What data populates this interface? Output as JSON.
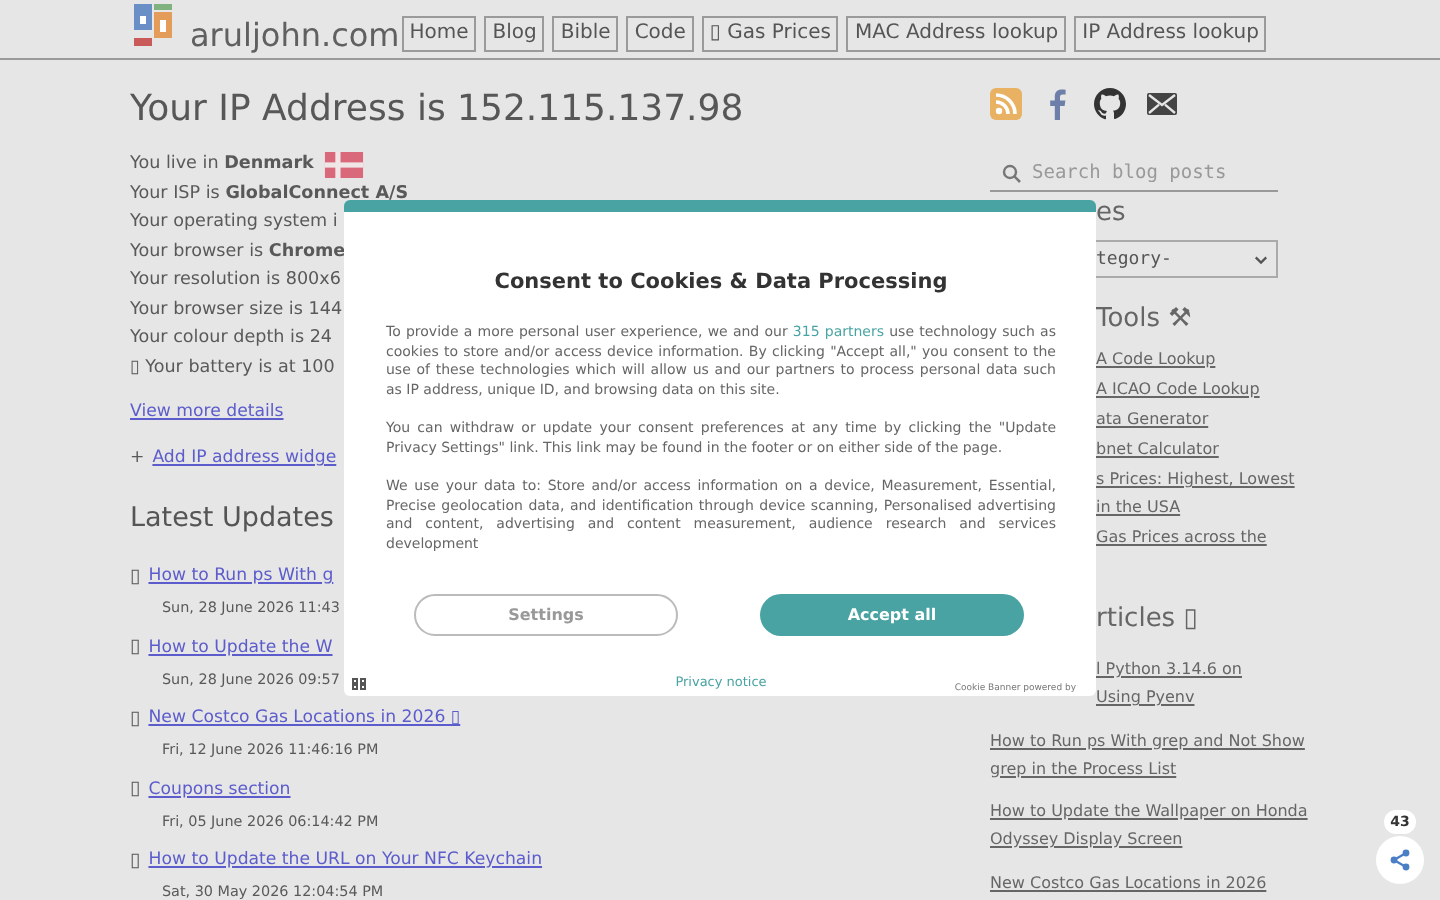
{
  "header": {
    "site_name": "aruljohn.com",
    "nav": [
      {
        "label": "Home"
      },
      {
        "label": "Blog"
      },
      {
        "label": "Bible"
      },
      {
        "label": "Code"
      },
      {
        "label": "▯ Gas Prices"
      },
      {
        "label": "MAC Address lookup"
      },
      {
        "label": "IP Address lookup"
      }
    ]
  },
  "main": {
    "title": "Your IP Address is 152.115.137.98",
    "info_lines": [
      {
        "text": "You live in **Denmark**",
        "flag": true
      },
      {
        "text": "Your ISP is **GlobalConnect A/S**",
        "flag": false
      },
      {
        "text": "Your operating system i",
        "flag": false
      },
      {
        "text": "Your browser is **Chrome**",
        "flag": false
      },
      {
        "text": "Your resolution is 800x6",
        "flag": false
      },
      {
        "text": "Your browser size is 144",
        "flag": false
      },
      {
        "text": "Your colour depth is 24",
        "flag": false
      },
      {
        "text": "▯ Your battery is at 100",
        "flag": false
      }
    ],
    "view_more_link": "View more details",
    "widget_link": {
      "prefix": "+",
      "label": "Add IP address widge"
    },
    "latest": {
      "heading": "Latest Updates",
      "items": [
        {
          "icon": "▯",
          "title": "How to Run ps With g",
          "date": "Sun, 28 June 2026 11:43"
        },
        {
          "icon": "▯",
          "title": "How to Update the W",
          "date": "Sun, 28 June 2026 09:57"
        },
        {
          "icon": "▯",
          "title": "New Costco Gas Locations in 2026 ▯",
          "date": "Fri, 12 June 2026 11:46:16 PM"
        },
        {
          "icon": "▯",
          "title": "Coupons section",
          "date": "Fri, 05 June 2026 06:14:42 PM"
        },
        {
          "icon": "▯",
          "title": "How to Update the URL on Your NFC Keychain",
          "date": "Sat, 30 May 2026 12:04:54 PM"
        }
      ]
    }
  },
  "sidebar": {
    "search": {
      "placeholder": "Search blog posts"
    },
    "categories": {
      "heading": "es",
      "select": "tegory-"
    },
    "tools": {
      "heading": "Tools ⚒",
      "links": [
        {
          "lines": [
            "A Code Lookup"
          ]
        },
        {
          "lines": [
            "A ICAO Code Lookup"
          ]
        },
        {
          "lines": [
            "ata Generator"
          ]
        },
        {
          "lines": [
            "bnet Calculator"
          ]
        },
        {
          "lines": [
            "s Prices: Highest, Lowest",
            "in the USA"
          ]
        },
        {
          "lines": [
            "Gas Prices across the"
          ]
        }
      ]
    },
    "articles": {
      "heading": "rticles ▯",
      "links": [
        {
          "kind": "covered",
          "lines": [
            "l Python 3.14.6 on",
            "Using Pyenv"
          ]
        },
        {
          "kind": "full",
          "lines": [
            "How to Run ps With grep and Not Show",
            "grep in the Process List"
          ]
        },
        {
          "kind": "full",
          "lines": [
            "How to Update the Wallpaper on Honda",
            "Odyssey Display Screen"
          ]
        },
        {
          "kind": "full",
          "lines": [
            "New Costco Gas Locations in 2026"
          ]
        }
      ]
    }
  },
  "consent_dialog": {
    "title": "Consent to Cookies & Data Processing",
    "paragraphs": [
      {
        "parts": [
          {
            "kind": "text",
            "text": "To provide a more personal user experience, we and our "
          },
          {
            "kind": "link",
            "text": "315 partners"
          },
          {
            "kind": "text",
            "text": " use technology such as cookies to store and/or access device information. By clicking \"Accept all,\" you consent to the use of these technologies which will allow us and our partners to process personal data such as IP address, unique ID, and browsing data on this site."
          }
        ]
      },
      {
        "parts": [
          {
            "kind": "text",
            "text": "You can withdraw or update your consent preferences at any time by clicking the \"Update Privacy Settings\" link. This link may be found in the footer or on either side of the page."
          }
        ]
      },
      {
        "parts": [
          {
            "kind": "text",
            "text": "We use your data to: Store and/or access information on a device, Measurement, Essential, Precise geolocation data, and identification through device scanning, Personalised advertising and content, advertising and content measurement, audience research and services development"
          }
        ]
      }
    ],
    "settings_button": "Settings",
    "accept_button": "Accept all",
    "privacy_link": "Privacy notice",
    "powered_by": "Cookie Banner powered by"
  },
  "share_widget": {
    "count": "43"
  }
}
